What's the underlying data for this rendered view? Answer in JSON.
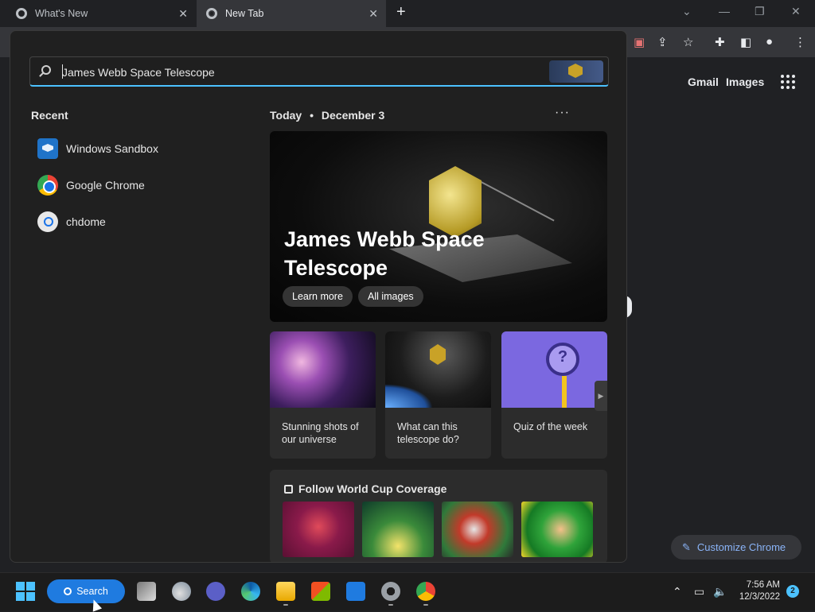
{
  "browser": {
    "tabs": [
      {
        "label": "What's New",
        "active": false
      },
      {
        "label": "New Tab",
        "active": true
      }
    ],
    "new_tab_symbol": "+",
    "window_controls": [
      "chevron-down",
      "minimize",
      "restore",
      "close"
    ],
    "toolbar_icons": [
      "extension-blocked-icon",
      "share-icon",
      "star-icon",
      "puzzle-icon",
      "side-panel-icon",
      "profile-icon",
      "kebab-menu-icon"
    ]
  },
  "ntp": {
    "links": [
      "Gmail",
      "Images"
    ],
    "customize_label": "Customize Chrome"
  },
  "search_panel": {
    "query": "James Webb Space Telescope",
    "recent_title": "Recent",
    "recent": [
      {
        "label": "Windows Sandbox",
        "icon": "sandbox-icon"
      },
      {
        "label": "Google Chrome",
        "icon": "chrome-icon"
      },
      {
        "label": "chdome",
        "icon": "search-result-icon"
      }
    ],
    "today_label": "Today",
    "separator": "•",
    "date": "December 3",
    "more": "···",
    "hero": {
      "title": "James Webb Space Telescope",
      "buttons": [
        "Learn more",
        "All images"
      ]
    },
    "cards": [
      {
        "caption": "Stunning shots of our universe"
      },
      {
        "caption": "What can this telescope do?"
      },
      {
        "caption": "Quiz of the week"
      }
    ],
    "world_cup": {
      "title": "Follow World Cup Coverage"
    }
  },
  "taskbar": {
    "search_label": "Search",
    "clock_time": "7:56 AM",
    "clock_date": "12/3/2022",
    "notification_count": "2"
  },
  "colors": {
    "accent": "#4cc2ff",
    "search_button": "#1f7be0",
    "link_blue": "#8ab4f8"
  }
}
